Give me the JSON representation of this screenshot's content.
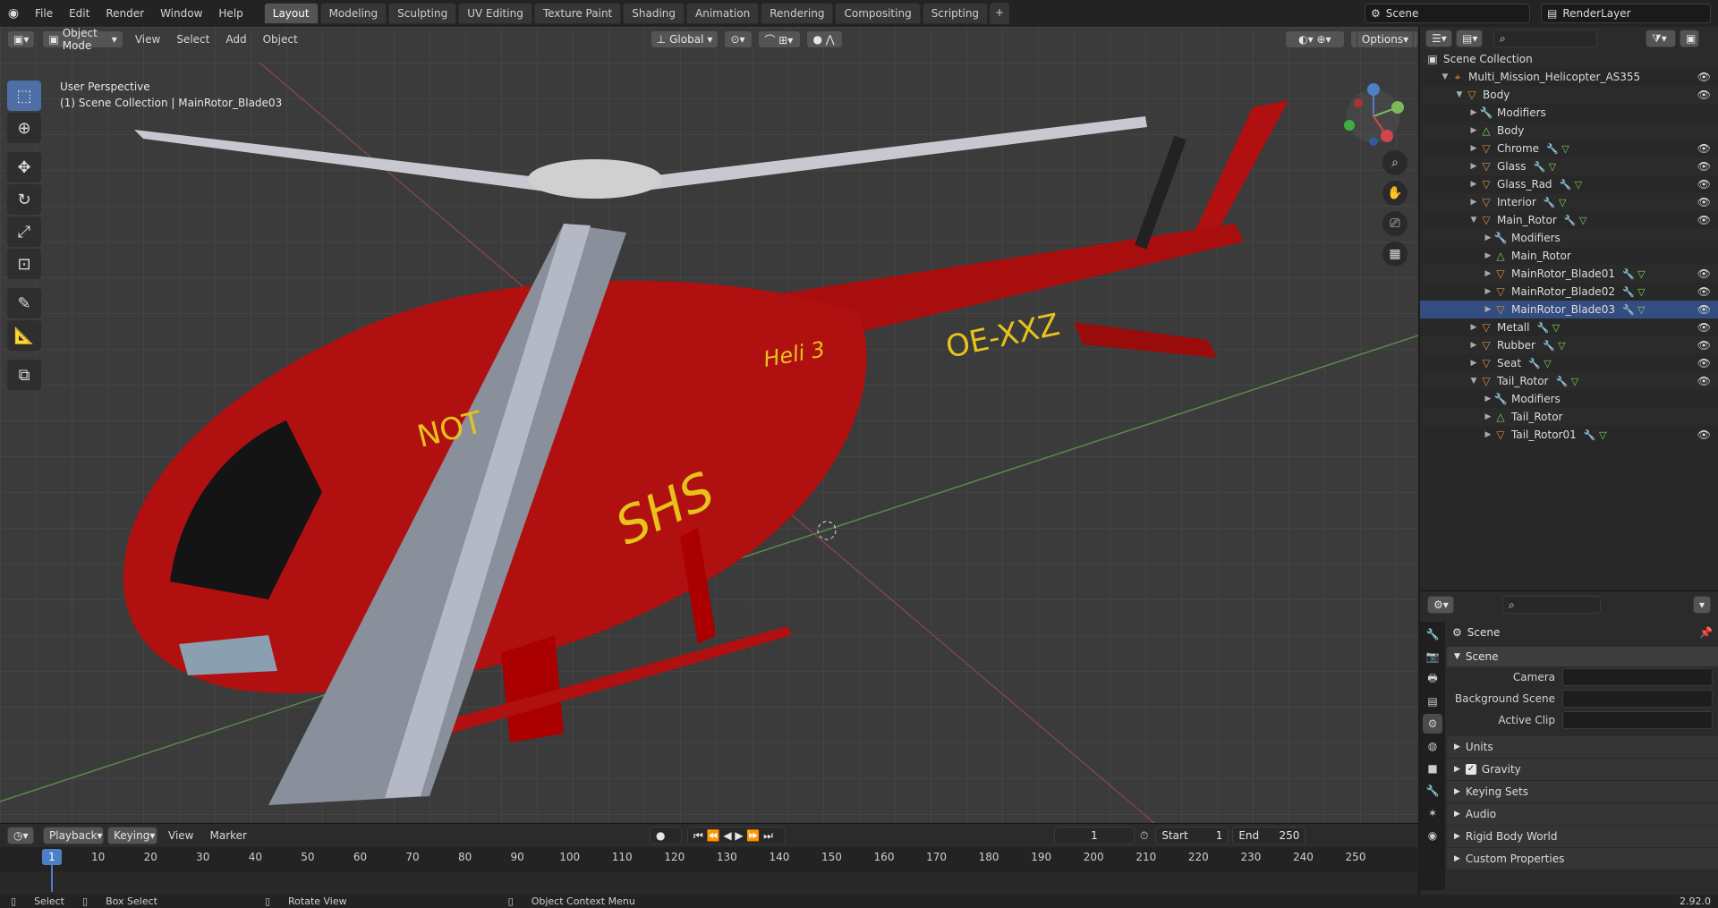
{
  "menu": [
    "File",
    "Edit",
    "Render",
    "Window",
    "Help"
  ],
  "workspaces": [
    "Layout",
    "Modeling",
    "Sculpting",
    "UV Editing",
    "Texture Paint",
    "Shading",
    "Animation",
    "Rendering",
    "Compositing",
    "Scripting"
  ],
  "active_workspace": "Layout",
  "scene_name": "Scene",
  "render_layer": "RenderLayer",
  "viewport": {
    "mode": "Object Mode",
    "menus": [
      "View",
      "Select",
      "Add",
      "Object"
    ],
    "transform_orientation": "Global",
    "options_label": "Options",
    "info_line1": "User Perspective",
    "info_line2": "(1) Scene Collection | MainRotor_Blade03",
    "livery": {
      "callsign": "OE-XXZ",
      "name": "Heli 3",
      "logo": "SHS",
      "nose": "NOT"
    }
  },
  "timeline": {
    "menus": [
      "Playback",
      "Keying",
      "View",
      "Marker"
    ],
    "current_frame": "1",
    "start_label": "Start",
    "start": "1",
    "end_label": "End",
    "end": "250",
    "ticks": [
      "10",
      "20",
      "30",
      "40",
      "50",
      "60",
      "70",
      "80",
      "90",
      "100",
      "110",
      "120",
      "130",
      "140",
      "150",
      "160",
      "170",
      "180",
      "190",
      "200",
      "210",
      "220",
      "230",
      "240",
      "250"
    ]
  },
  "outliner": {
    "root": "Scene Collection",
    "rows": [
      {
        "label": "Multi_Mission_Helicopter_AS355",
        "depth": 1,
        "icon": "empty-icon",
        "eye": true
      },
      {
        "label": "Body",
        "depth": 2,
        "icon": "mesh-object-icon",
        "eye": true
      },
      {
        "label": "Modifiers",
        "depth": 3,
        "icon": "wrench-icon",
        "eye": false
      },
      {
        "label": "Body",
        "depth": 3,
        "icon": "mesh-data-icon",
        "eye": false
      },
      {
        "label": "Chrome",
        "depth": 3,
        "icon": "mesh-object-icon",
        "eye": true
      },
      {
        "label": "Glass",
        "depth": 3,
        "icon": "mesh-object-icon",
        "eye": true
      },
      {
        "label": "Glass_Rad",
        "depth": 3,
        "icon": "mesh-object-icon",
        "eye": true
      },
      {
        "label": "Interior",
        "depth": 3,
        "icon": "mesh-object-icon",
        "eye": true
      },
      {
        "label": "Main_Rotor",
        "depth": 3,
        "icon": "mesh-object-icon",
        "eye": true
      },
      {
        "label": "Modifiers",
        "depth": 4,
        "icon": "wrench-icon",
        "eye": false
      },
      {
        "label": "Main_Rotor",
        "depth": 4,
        "icon": "mesh-data-icon",
        "eye": false
      },
      {
        "label": "MainRotor_Blade01",
        "depth": 4,
        "icon": "mesh-object-icon",
        "eye": true
      },
      {
        "label": "MainRotor_Blade02",
        "depth": 4,
        "icon": "mesh-object-icon",
        "eye": true
      },
      {
        "label": "MainRotor_Blade03",
        "depth": 4,
        "icon": "mesh-object-icon",
        "eye": true,
        "selected": true
      },
      {
        "label": "Metall",
        "depth": 3,
        "icon": "mesh-object-icon",
        "eye": true
      },
      {
        "label": "Rubber",
        "depth": 3,
        "icon": "mesh-object-icon",
        "eye": true
      },
      {
        "label": "Seat",
        "depth": 3,
        "icon": "mesh-object-icon",
        "eye": true
      },
      {
        "label": "Tail_Rotor",
        "depth": 3,
        "icon": "mesh-object-icon",
        "eye": true
      },
      {
        "label": "Modifiers",
        "depth": 4,
        "icon": "wrench-icon",
        "eye": false
      },
      {
        "label": "Tail_Rotor",
        "depth": 4,
        "icon": "mesh-data-icon",
        "eye": false
      },
      {
        "label": "Tail_Rotor01",
        "depth": 4,
        "icon": "mesh-object-icon",
        "eye": true
      }
    ]
  },
  "properties": {
    "context_title": "Scene",
    "panel_scene": "Scene",
    "fields": [
      {
        "label": "Camera"
      },
      {
        "label": "Background Scene"
      },
      {
        "label": "Active Clip"
      }
    ],
    "subpanels": [
      "Units",
      "Gravity",
      "Keying Sets",
      "Audio",
      "Rigid Body World",
      "Custom Properties"
    ]
  },
  "status": {
    "items": [
      "Select",
      "Box Select",
      "Rotate View",
      "Object Context Menu"
    ],
    "version": "2.92.0"
  },
  "colors": {
    "accent": "#4d7fc6",
    "heli_red": "#b01010",
    "livery_yellow": "#e7c21b",
    "outliner_orange": "#e08a3a"
  }
}
